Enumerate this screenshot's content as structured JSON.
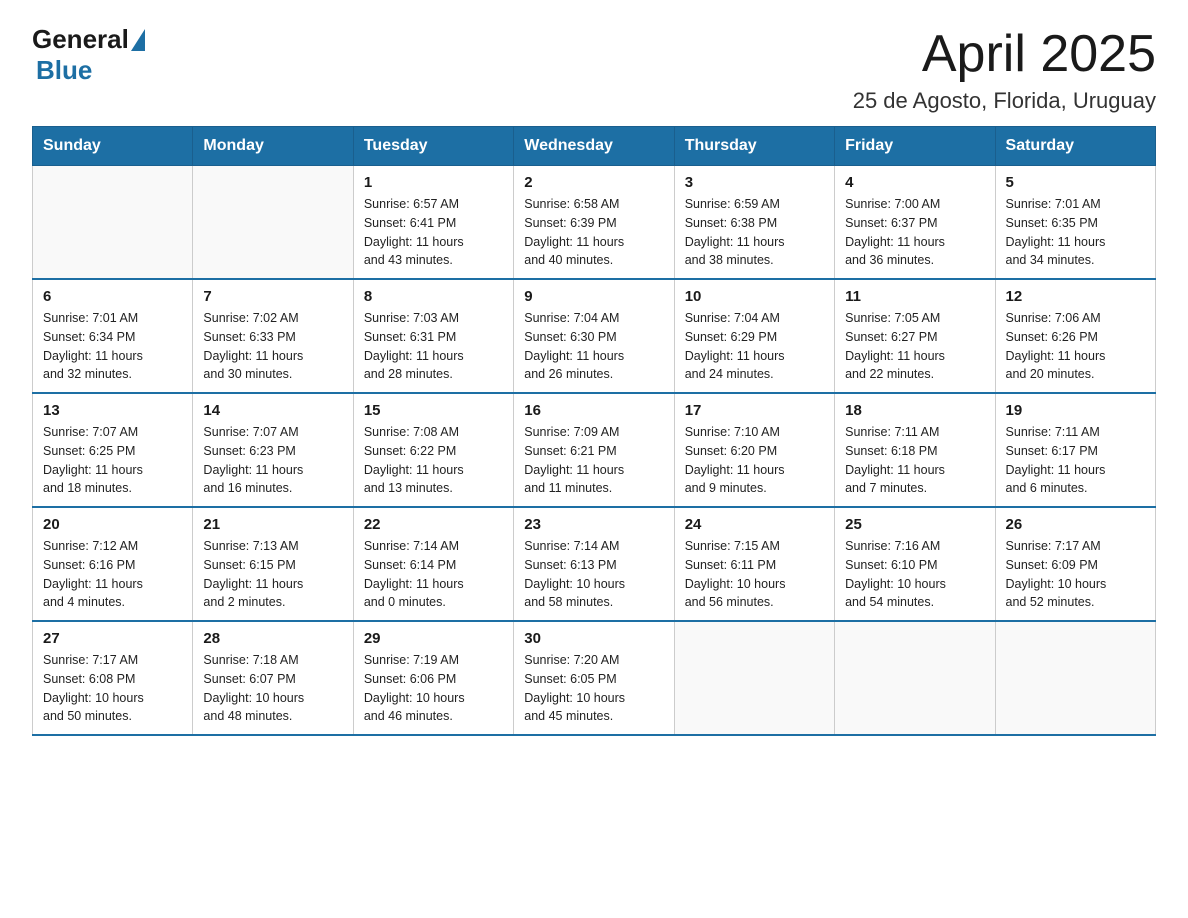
{
  "header": {
    "logo_general": "General",
    "logo_blue": "Blue",
    "month_title": "April 2025",
    "subtitle": "25 de Agosto, Florida, Uruguay"
  },
  "calendar": {
    "days_of_week": [
      "Sunday",
      "Monday",
      "Tuesday",
      "Wednesday",
      "Thursday",
      "Friday",
      "Saturday"
    ],
    "weeks": [
      [
        {
          "day": "",
          "info": ""
        },
        {
          "day": "",
          "info": ""
        },
        {
          "day": "1",
          "info": "Sunrise: 6:57 AM\nSunset: 6:41 PM\nDaylight: 11 hours\nand 43 minutes."
        },
        {
          "day": "2",
          "info": "Sunrise: 6:58 AM\nSunset: 6:39 PM\nDaylight: 11 hours\nand 40 minutes."
        },
        {
          "day": "3",
          "info": "Sunrise: 6:59 AM\nSunset: 6:38 PM\nDaylight: 11 hours\nand 38 minutes."
        },
        {
          "day": "4",
          "info": "Sunrise: 7:00 AM\nSunset: 6:37 PM\nDaylight: 11 hours\nand 36 minutes."
        },
        {
          "day": "5",
          "info": "Sunrise: 7:01 AM\nSunset: 6:35 PM\nDaylight: 11 hours\nand 34 minutes."
        }
      ],
      [
        {
          "day": "6",
          "info": "Sunrise: 7:01 AM\nSunset: 6:34 PM\nDaylight: 11 hours\nand 32 minutes."
        },
        {
          "day": "7",
          "info": "Sunrise: 7:02 AM\nSunset: 6:33 PM\nDaylight: 11 hours\nand 30 minutes."
        },
        {
          "day": "8",
          "info": "Sunrise: 7:03 AM\nSunset: 6:31 PM\nDaylight: 11 hours\nand 28 minutes."
        },
        {
          "day": "9",
          "info": "Sunrise: 7:04 AM\nSunset: 6:30 PM\nDaylight: 11 hours\nand 26 minutes."
        },
        {
          "day": "10",
          "info": "Sunrise: 7:04 AM\nSunset: 6:29 PM\nDaylight: 11 hours\nand 24 minutes."
        },
        {
          "day": "11",
          "info": "Sunrise: 7:05 AM\nSunset: 6:27 PM\nDaylight: 11 hours\nand 22 minutes."
        },
        {
          "day": "12",
          "info": "Sunrise: 7:06 AM\nSunset: 6:26 PM\nDaylight: 11 hours\nand 20 minutes."
        }
      ],
      [
        {
          "day": "13",
          "info": "Sunrise: 7:07 AM\nSunset: 6:25 PM\nDaylight: 11 hours\nand 18 minutes."
        },
        {
          "day": "14",
          "info": "Sunrise: 7:07 AM\nSunset: 6:23 PM\nDaylight: 11 hours\nand 16 minutes."
        },
        {
          "day": "15",
          "info": "Sunrise: 7:08 AM\nSunset: 6:22 PM\nDaylight: 11 hours\nand 13 minutes."
        },
        {
          "day": "16",
          "info": "Sunrise: 7:09 AM\nSunset: 6:21 PM\nDaylight: 11 hours\nand 11 minutes."
        },
        {
          "day": "17",
          "info": "Sunrise: 7:10 AM\nSunset: 6:20 PM\nDaylight: 11 hours\nand 9 minutes."
        },
        {
          "day": "18",
          "info": "Sunrise: 7:11 AM\nSunset: 6:18 PM\nDaylight: 11 hours\nand 7 minutes."
        },
        {
          "day": "19",
          "info": "Sunrise: 7:11 AM\nSunset: 6:17 PM\nDaylight: 11 hours\nand 6 minutes."
        }
      ],
      [
        {
          "day": "20",
          "info": "Sunrise: 7:12 AM\nSunset: 6:16 PM\nDaylight: 11 hours\nand 4 minutes."
        },
        {
          "day": "21",
          "info": "Sunrise: 7:13 AM\nSunset: 6:15 PM\nDaylight: 11 hours\nand 2 minutes."
        },
        {
          "day": "22",
          "info": "Sunrise: 7:14 AM\nSunset: 6:14 PM\nDaylight: 11 hours\nand 0 minutes."
        },
        {
          "day": "23",
          "info": "Sunrise: 7:14 AM\nSunset: 6:13 PM\nDaylight: 10 hours\nand 58 minutes."
        },
        {
          "day": "24",
          "info": "Sunrise: 7:15 AM\nSunset: 6:11 PM\nDaylight: 10 hours\nand 56 minutes."
        },
        {
          "day": "25",
          "info": "Sunrise: 7:16 AM\nSunset: 6:10 PM\nDaylight: 10 hours\nand 54 minutes."
        },
        {
          "day": "26",
          "info": "Sunrise: 7:17 AM\nSunset: 6:09 PM\nDaylight: 10 hours\nand 52 minutes."
        }
      ],
      [
        {
          "day": "27",
          "info": "Sunrise: 7:17 AM\nSunset: 6:08 PM\nDaylight: 10 hours\nand 50 minutes."
        },
        {
          "day": "28",
          "info": "Sunrise: 7:18 AM\nSunset: 6:07 PM\nDaylight: 10 hours\nand 48 minutes."
        },
        {
          "day": "29",
          "info": "Sunrise: 7:19 AM\nSunset: 6:06 PM\nDaylight: 10 hours\nand 46 minutes."
        },
        {
          "day": "30",
          "info": "Sunrise: 7:20 AM\nSunset: 6:05 PM\nDaylight: 10 hours\nand 45 minutes."
        },
        {
          "day": "",
          "info": ""
        },
        {
          "day": "",
          "info": ""
        },
        {
          "day": "",
          "info": ""
        }
      ]
    ]
  }
}
